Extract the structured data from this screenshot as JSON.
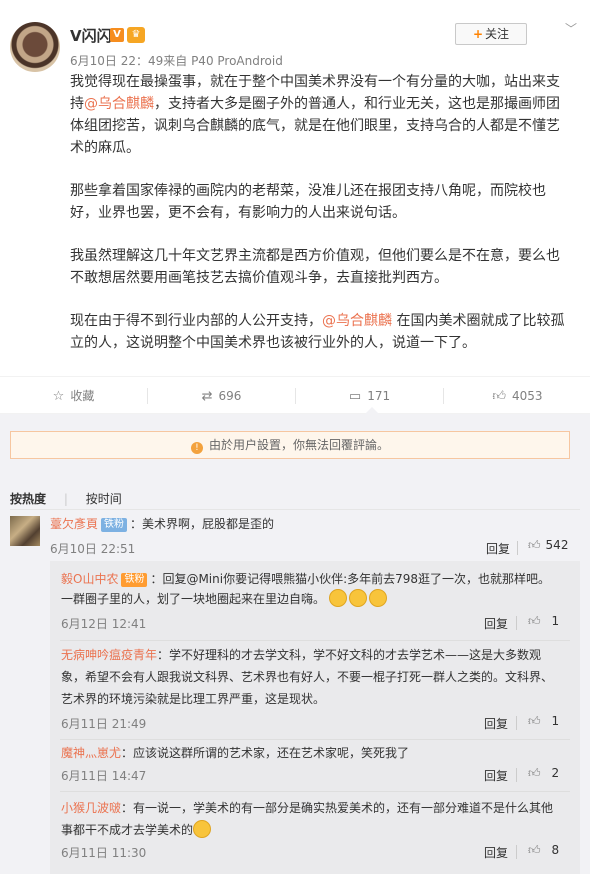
{
  "post": {
    "username": "V闪闪",
    "v_badge": "V",
    "meta": "6月10日 22：49来自 P40 ProAndroid",
    "follow_label": "关注",
    "paragraphs": [
      {
        "pre": "我觉得现在最操蛋事，就在于整个中国美术界没有一个有分量的大咖，站出来支持",
        "mention": "@乌合麒麟",
        "post": "，支持者大多是圈子外的普通人，和行业无关，这也是那撮画师团体组团挖苦，讽刺乌合麒麟的底气，就是在他们眼里，支持乌合的人都是不懂艺术的麻瓜。"
      },
      {
        "pre": "那些拿着国家俸禄的画院内的老帮菜，没准儿还在报团支持八角呢，而院校也好，业界也罢，更不会有，有影响力的人出来说句话。",
        "mention": "",
        "post": ""
      },
      {
        "pre": "我虽然理解这几十年文艺界主流都是西方价值观，但他们要么是不在意，要么也不敢想居然要用画笔技艺去搞价值观斗争，去直接批判西方。",
        "mention": "",
        "post": ""
      },
      {
        "pre": "现在由于得不到行业内部的人公开支持，",
        "mention": "@乌合麒麟",
        "post": " 在国内美术圈就成了比较孤立的人，这说明整个中国美术界也该被行业外的人，说道一下了。"
      }
    ]
  },
  "actions": {
    "favorite": "收藏",
    "repost": "696",
    "comment": "171",
    "like": "4053"
  },
  "notice": "由於用户設置，你無法回覆評論。",
  "sort": {
    "hot": "按热度",
    "time": "按时间"
  },
  "top_comment": {
    "name": "薹欠彥頁",
    "badge": "铁粉",
    "text": "：美术界啊，屁股都是歪的",
    "time": "6月10日 22:51",
    "reply": "回复",
    "likes": "542"
  },
  "sub_comments": [
    {
      "name": "毅O山中农",
      "badge": "铁粉",
      "text_line1": "：回复@Mini你要记得喂熊猫小伙伴:多年前去798逛了一次，也就那样吧。",
      "text_line2": "一群圈子里的人，划了一块地圈起来在里边自嗨。",
      "time": "6月12日 12:41",
      "reply": "回复",
      "likes": "1"
    },
    {
      "name": "无病呻吟瘟疫青年",
      "badge": "",
      "text_line1": "：学不好理科的才去学文科，学不好文科的才去学艺术——这是大多数观",
      "text_line2": "象，希望不会有人跟我说文科界、艺术界也有好人，不要一棍子打死一群人之类的。文科界、",
      "text_line3": "艺术界的环境污染就是比理工界严重，这是现状。",
      "time": "6月11日 21:49",
      "reply": "回复",
      "likes": "1"
    },
    {
      "name": "魔神灬崽尤",
      "badge": "",
      "text_line1": "：应该说这群所谓的艺术家，还在艺术家呢，笑死我了",
      "time": "6月11日 14:47",
      "reply": "回复",
      "likes": "2"
    },
    {
      "name": "小猴几波啵",
      "badge": "",
      "text_line1": "：有一说一，学美术的有一部分是确实热爱美术的，还有一部分难道不是什么其他",
      "text_line2": "事都干不成才去学美术的",
      "time": "6月11日 11:30",
      "reply": "回复",
      "likes": "8"
    }
  ]
}
